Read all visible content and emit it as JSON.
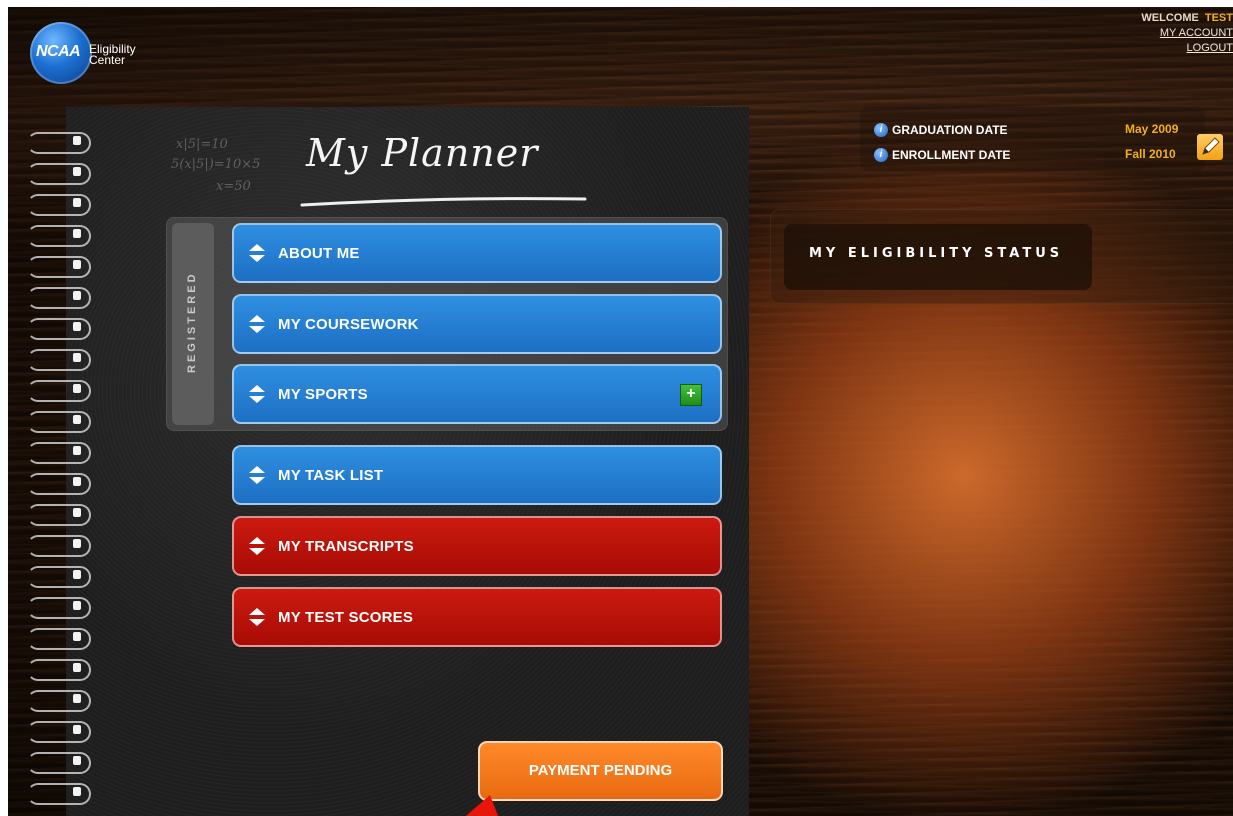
{
  "header": {
    "logo_word": "NCAA",
    "logo_sub": "Eligibility Center",
    "welcome_label": "WELCOME",
    "user_name": "TEST",
    "my_account": "MY ACCOUNT",
    "logout": "LOGOUT"
  },
  "planner": {
    "title": "My Planner",
    "chalk_notes": [
      "x|5|=10",
      "5(x|5|)=10×5",
      "x=50"
    ],
    "registered_label": "REGISTERED",
    "menu": [
      {
        "label": "ABOUT ME",
        "color": "blue"
      },
      {
        "label": "MY COURSEWORK",
        "color": "blue"
      },
      {
        "label": "MY SPORTS",
        "color": "blue"
      },
      {
        "label": "MY TASK LIST",
        "color": "blue"
      },
      {
        "label": "MY TRANSCRIPTS",
        "color": "red"
      },
      {
        "label": "MY TEST SCORES",
        "color": "red"
      }
    ],
    "add_sport_label": "+",
    "payment_button": "PAYMENT PENDING"
  },
  "dates": {
    "graduation_label": "GRADUATION DATE",
    "graduation_value": "May 2009",
    "enrollment_label": "ENROLLMENT DATE",
    "enrollment_value": "Fall 2010"
  },
  "status": {
    "title": "MY ELIGIBILITY STATUS"
  },
  "colors": {
    "blue_button": "#1d6fc4",
    "red_button": "#a70c05",
    "orange_button": "#e86a10",
    "accent_gold": "#f3b11a"
  }
}
